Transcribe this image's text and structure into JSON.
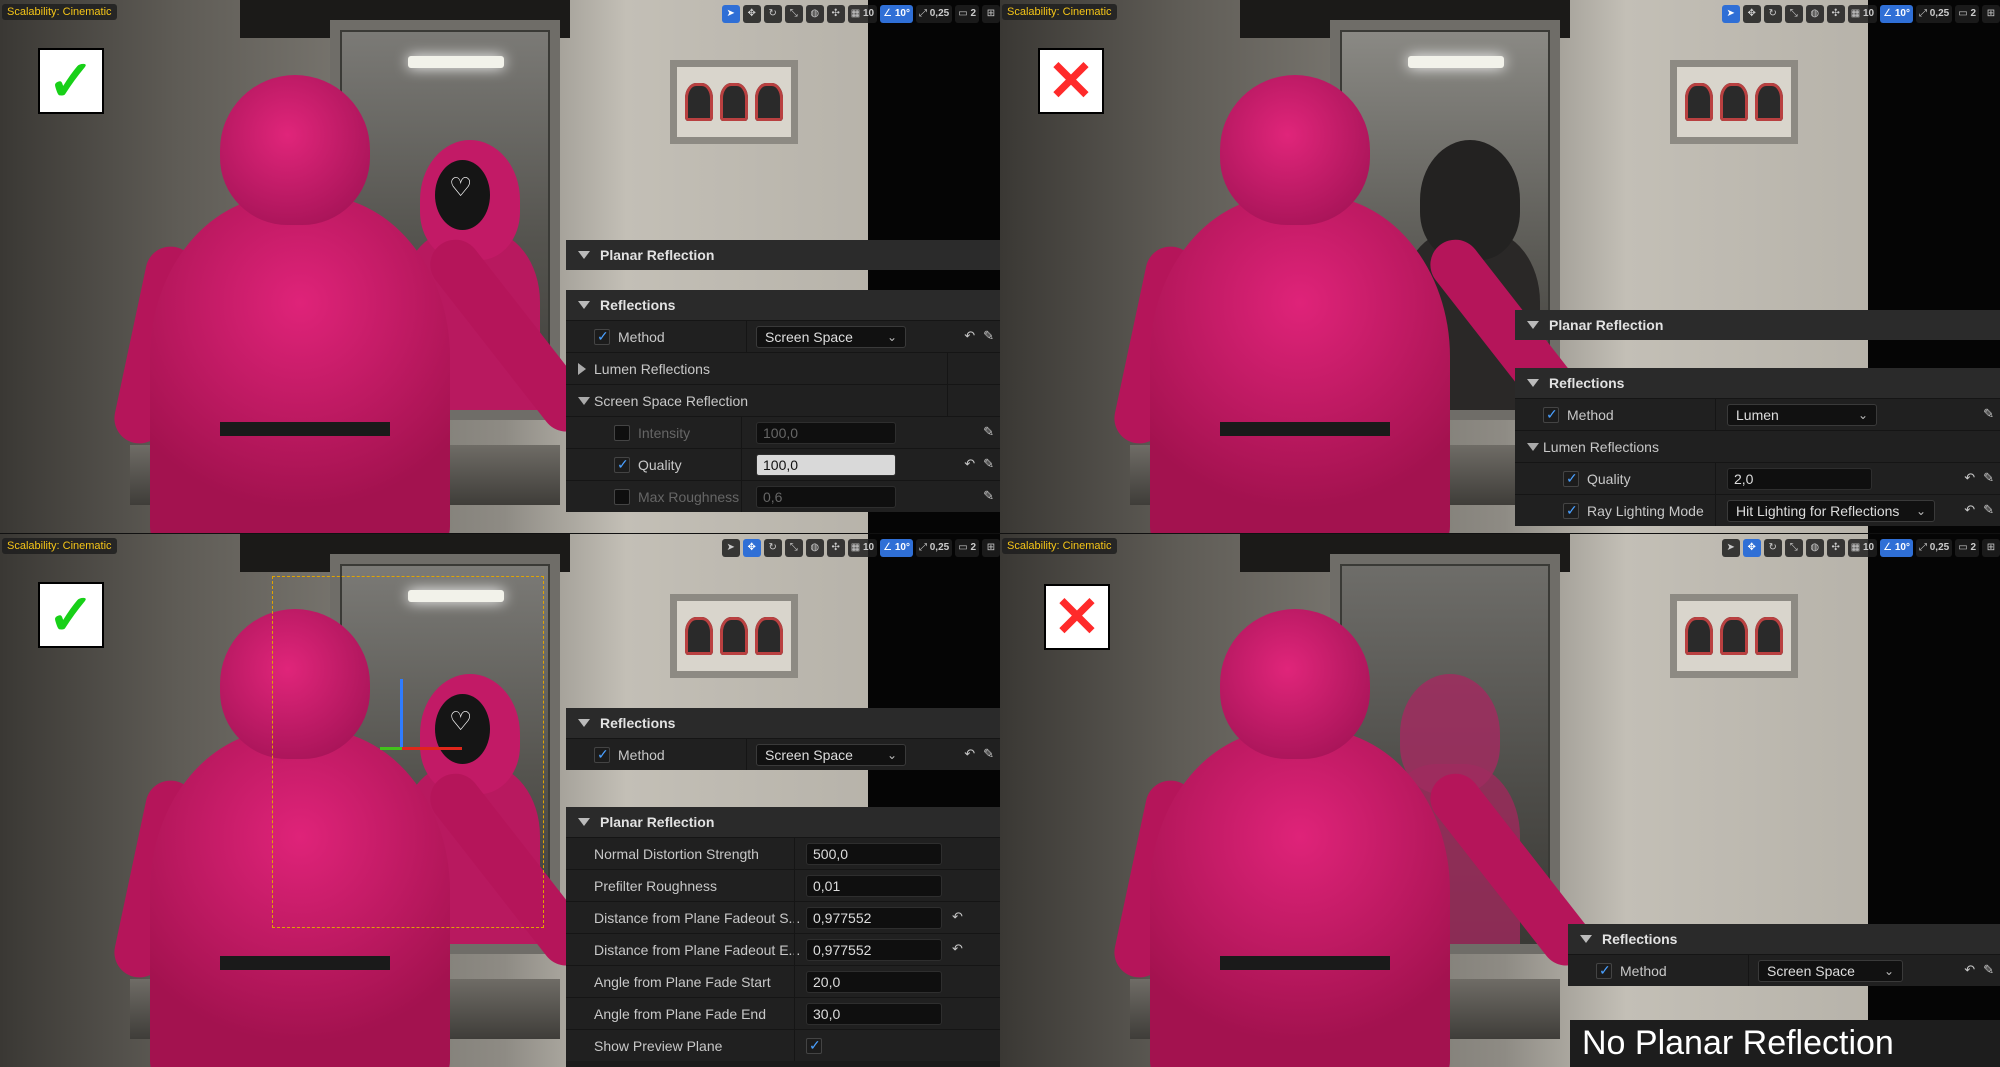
{
  "quadrants": [
    {
      "scalability": "Scalability: Cinematic",
      "verdict": "✓"
    },
    {
      "scalability": "Scalability: Cinematic",
      "verdict": "✕"
    },
    {
      "scalability": "Scalability: Cinematic",
      "verdict": "✓"
    },
    {
      "scalability": "Scalability: Cinematic",
      "verdict": "✕"
    }
  ],
  "toolbar": {
    "grid": "10",
    "angle": "10°",
    "scale": "0,25",
    "cam": "2"
  },
  "q0": {
    "planar_header": "Planar Reflection",
    "reflections_header": "Reflections",
    "method_label": "Method",
    "method_value": "Screen Space",
    "lumen_reflections": "Lumen Reflections",
    "ssr_header": "Screen Space Reflection",
    "intensity_label": "Intensity",
    "intensity_value": "100,0",
    "quality_label": "Quality",
    "quality_value": "100,0",
    "max_roughness_label": "Max Roughness",
    "max_roughness_value": "0,6"
  },
  "q1": {
    "planar_header": "Planar Reflection",
    "reflections_header": "Reflections",
    "method_label": "Method",
    "method_value": "Lumen",
    "lumen_header": "Lumen Reflections",
    "quality_label": "Quality",
    "quality_value": "2,0",
    "ray_label": "Ray Lighting Mode",
    "ray_value": "Hit Lighting for Reflections"
  },
  "q2": {
    "reflections_header": "Reflections",
    "method_label": "Method",
    "method_value": "Screen Space",
    "planar_header": "Planar Reflection",
    "rows": [
      {
        "label": "Normal Distortion Strength",
        "value": "500,0"
      },
      {
        "label": "Prefilter Roughness",
        "value": "0,01"
      },
      {
        "label": "Distance from Plane Fadeout S...",
        "value": "0,977552"
      },
      {
        "label": "Distance from Plane Fadeout E...",
        "value": "0,977552"
      },
      {
        "label": "Angle from Plane Fade Start",
        "value": "20,0"
      },
      {
        "label": "Angle from Plane Fade End",
        "value": "30,0"
      }
    ],
    "preview_label": "Show Preview Plane"
  },
  "q3": {
    "reflections_header": "Reflections",
    "method_label": "Method",
    "method_value": "Screen Space"
  },
  "caption": "No Planar Reflection",
  "colors": {
    "accent": "#2f6fd6",
    "scalability": "#f5c518",
    "check": "#18d018",
    "cross": "#ff2a2a"
  }
}
